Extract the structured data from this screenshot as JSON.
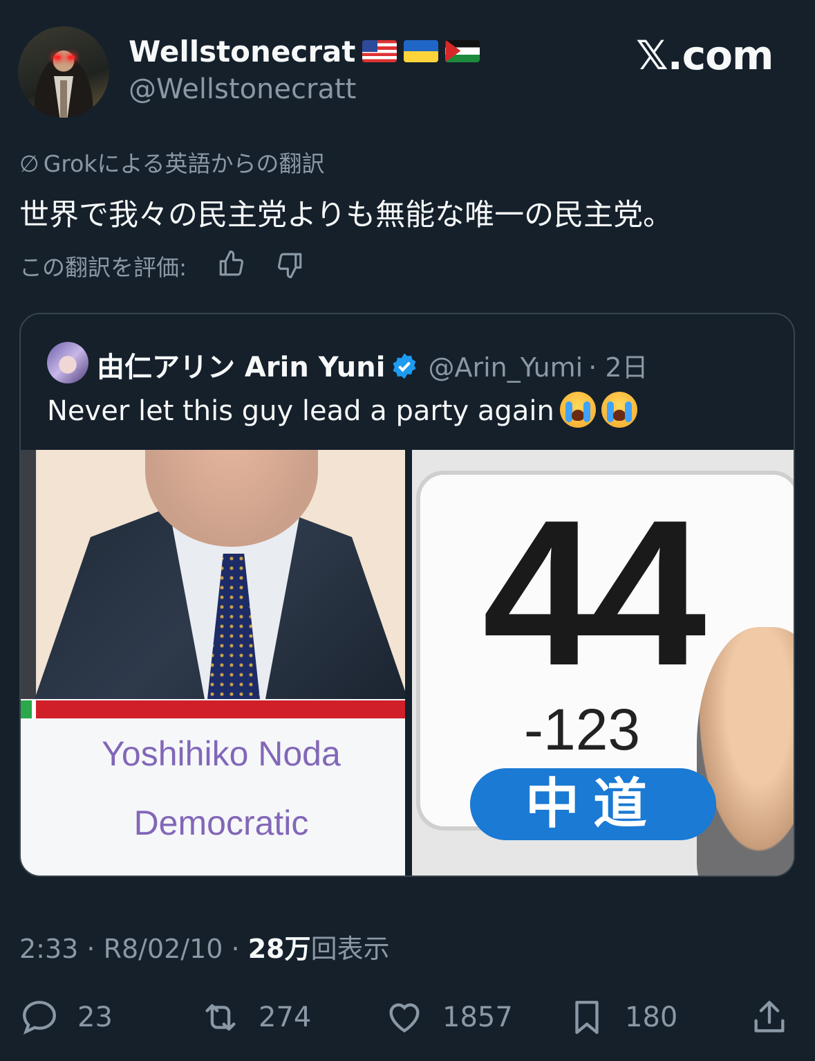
{
  "author": {
    "name": "Wellstonecrat",
    "handle": "@Wellstonecratt",
    "flags": [
      "us-flag",
      "ukraine-flag",
      "palestine-flag"
    ]
  },
  "brand": "𝕏.com",
  "translation": {
    "note": "Grokによる英語からの翻訳",
    "text": "世界で我々の民主党よりも無能な唯一の民主党。",
    "rate_label": "この翻訳を評価:"
  },
  "quote": {
    "name": "由仁アリン Arin Yuni",
    "handle": "@Arin_Yumi",
    "time": "· 2日",
    "text": "Never let this guy lead a party again",
    "emoji": [
      "loudly-crying-face",
      "loudly-crying-face"
    ],
    "left_image": {
      "name_label": "Yoshihiko Noda",
      "party_label": "Democratic"
    },
    "right_image": {
      "seats": "44",
      "change": "-123",
      "party_badge": "中道"
    }
  },
  "meta": {
    "time": "2:33 · R8/02/10 · ",
    "views_count": "28万",
    "views_label": "回表示"
  },
  "actions": {
    "replies": "23",
    "reposts": "274",
    "likes": "1857",
    "bookmarks": "180"
  },
  "colors": {
    "background": "#15202b",
    "secondary_text": "#8b98a5",
    "verified": "#1d9bf0",
    "badge_blue": "#1a7ad4"
  }
}
